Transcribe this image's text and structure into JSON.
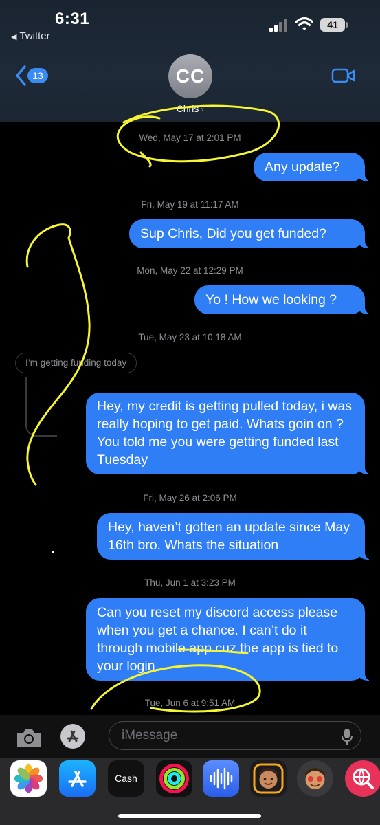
{
  "status_bar": {
    "time": "6:31",
    "back_app": "Twitter",
    "battery": "41"
  },
  "header": {
    "back_count": "13",
    "avatar_initials": "CC",
    "contact_name": "Chris",
    "name_chevron": "›"
  },
  "messages": [
    {
      "timestamp": {
        "day": "Wed, May 17",
        "time": "2:01 PM"
      },
      "text": "Any update?"
    },
    {
      "timestamp": {
        "day": "Fri, May 19",
        "time": "11:17 AM"
      },
      "text": "Sup Chris, Did you get funded?"
    },
    {
      "timestamp": {
        "day": "Mon, May 22",
        "time": "12:29 PM"
      },
      "text": "Yo ! How we looking ?"
    },
    {
      "timestamp": {
        "day": "Tue, May 23",
        "time": "10:18 AM"
      },
      "text": "Hey, my credit is getting pulled today, i was really hoping to get paid. Whats goin on ? You told me you were getting funded last Tuesday"
    },
    {
      "timestamp": {
        "day": "Fri, May 26",
        "time": "2:06 PM"
      },
      "text": "Hey, haven’t gotten an update since May 16th bro. Whats the situation"
    },
    {
      "timestamp": {
        "day": "Thu, Jun 1",
        "time": "3:23 PM"
      },
      "text": "Can you reset my discord access please when you get a chance. I can’t do it through mobile app cuz the app is tied to your login."
    }
  ],
  "reply_quote": "I’m getting funding today",
  "last_timestamp": {
    "day": "Tue, Jun 6",
    "time": "9:51 AM"
  },
  "timestamp_separator": " at ",
  "input": {
    "placeholder": "iMessage"
  },
  "app_drawer": [
    {
      "name": "photos-app-icon"
    },
    {
      "name": "app-store-icon"
    },
    {
      "name": "apple-cash-icon",
      "label": "Cash"
    },
    {
      "name": "fitness-icon"
    },
    {
      "name": "audio-message-icon"
    },
    {
      "name": "memoji-icon"
    },
    {
      "name": "memoji-stickers-icon"
    },
    {
      "name": "image-search-icon"
    }
  ],
  "colors": {
    "bubble_blue": "#2f7ef6",
    "badge_blue": "#3b8bf5",
    "annotation_yellow": "#f5f531",
    "timestamp_gray": "#8e8e93"
  }
}
